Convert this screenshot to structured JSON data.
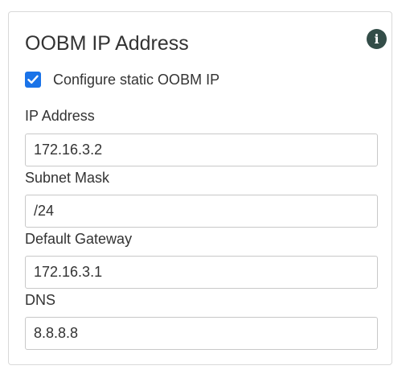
{
  "panel": {
    "title": "OOBM IP Address",
    "info_icon": "i",
    "checkbox": {
      "label": "Configure static OOBM IP",
      "checked": true,
      "color": "#1a73e8"
    },
    "fields": {
      "ip_address": {
        "label": "IP Address",
        "value": "172.16.3.2"
      },
      "subnet_mask": {
        "label": "Subnet Mask",
        "value": "/24"
      },
      "default_gateway": {
        "label": "Default Gateway",
        "value": "172.16.3.1"
      },
      "dns": {
        "label": "DNS",
        "value": "8.8.8.8"
      }
    }
  },
  "colors": {
    "info_icon_bg": "#334d48",
    "border": "#d9d9d9",
    "text": "#333333"
  }
}
